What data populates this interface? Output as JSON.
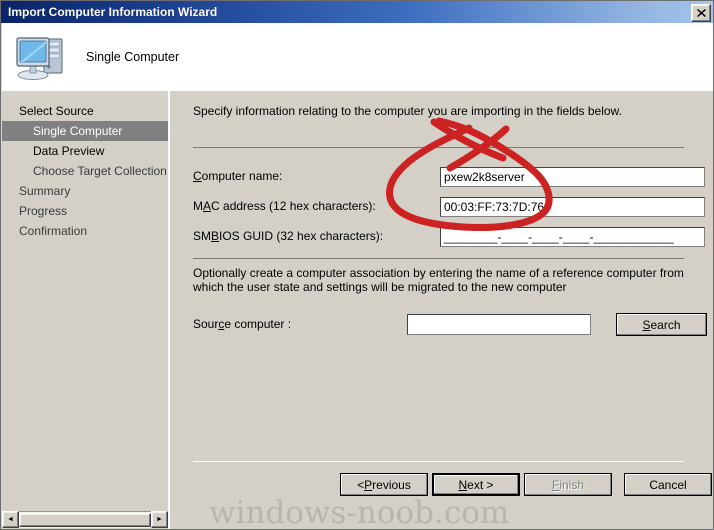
{
  "window": {
    "title": "Import Computer Information Wizard",
    "close_label": "✕"
  },
  "header": {
    "icon": "computer-icon",
    "title": "Single Computer"
  },
  "sidebar": {
    "items": [
      {
        "label": "Select Source",
        "level": 0,
        "state": "done"
      },
      {
        "label": "Single Computer",
        "level": 1,
        "state": "selected"
      },
      {
        "label": "Data Preview",
        "level": 1,
        "state": "done"
      },
      {
        "label": "Choose Target Collection",
        "level": 1,
        "state": "pending"
      },
      {
        "label": "Summary",
        "level": 0,
        "state": "pending"
      },
      {
        "label": "Progress",
        "level": 0,
        "state": "pending"
      },
      {
        "label": "Confirmation",
        "level": 0,
        "state": "pending"
      }
    ]
  },
  "main": {
    "intro": "Specify information relating to the computer you are importing in the fields below.",
    "fields": [
      {
        "label_pre": "",
        "label_acc": "C",
        "label_post": "omputer name:",
        "value": "pxew2k8server",
        "placeholder": ""
      },
      {
        "label_pre": "M",
        "label_acc": "A",
        "label_post": "C address (12 hex characters):",
        "value": "00:03:FF:73:7D:76",
        "placeholder": ""
      },
      {
        "label_pre": "SM",
        "label_acc": "B",
        "label_post": "IOS GUID (32 hex characters):",
        "value": "________-____-____-____-____________",
        "placeholder": ""
      }
    ],
    "association_text": "Optionally create a computer association by entering the name of a reference computer from which the user state and settings will be migrated to the new computer",
    "source_label_pre": "Sour",
    "source_label_acc": "c",
    "source_label_post": "e computer :",
    "source_value": "",
    "search_button": {
      "label_pre": "",
      "label_acc": "S",
      "label_post": "earch"
    }
  },
  "buttons": [
    {
      "name": "previous",
      "label_pre": "< ",
      "label_acc": "P",
      "label_post": "revious",
      "state": "enabled"
    },
    {
      "name": "next",
      "label_pre": "",
      "label_acc": "N",
      "label_post": "ext >",
      "state": "default"
    },
    {
      "name": "finish",
      "label_pre": "",
      "label_acc": "F",
      "label_post": "inish",
      "state": "disabled"
    },
    {
      "name": "cancel",
      "label_pre": "",
      "label_acc": "",
      "label_post": "Cancel",
      "state": "enabled"
    }
  ],
  "scrollbar": {
    "left_arrow": "◄",
    "right_arrow": "►"
  },
  "watermark": {
    "text": "windows-noob.com"
  },
  "annotation": {
    "color": "#cc2222",
    "type": "hand-drawn-circle-with-cross"
  },
  "colors": {
    "titlebar_start": "#0a246a",
    "titlebar_end": "#a6c6ea",
    "dialog_face": "#d4d0c8",
    "selected_nav": "#808080",
    "annotation_red": "#cc2222"
  }
}
